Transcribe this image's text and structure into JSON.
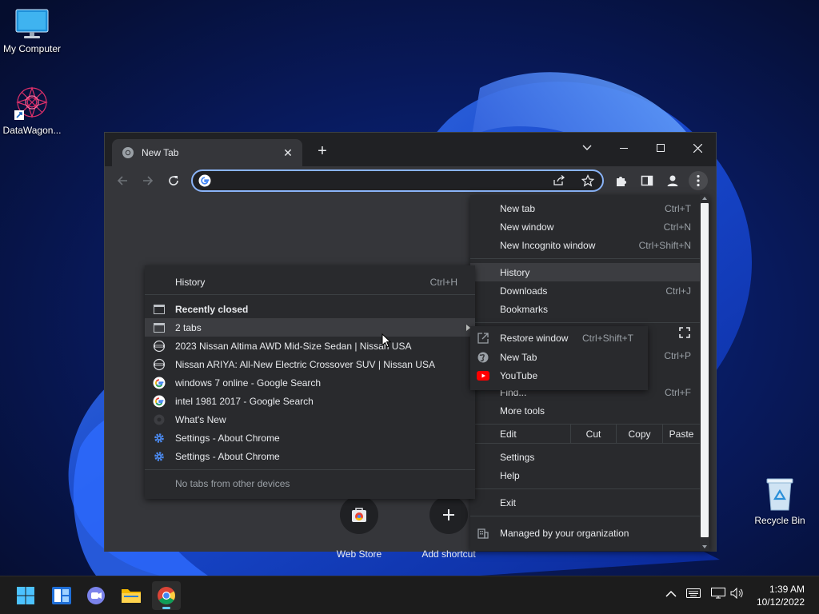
{
  "desktop": {
    "icons": [
      {
        "label": "My Computer"
      },
      {
        "label": "DataWagon..."
      },
      {
        "label": "Recycle Bin"
      }
    ]
  },
  "browser": {
    "tab_title": "New Tab",
    "omnibox_value": "",
    "shortcuts": [
      {
        "label": "Web Store"
      },
      {
        "label": "Add shortcut"
      }
    ]
  },
  "chrome_menu": {
    "items": [
      {
        "label": "New tab",
        "key": "Ctrl+T"
      },
      {
        "label": "New window",
        "key": "Ctrl+N"
      },
      {
        "label": "New Incognito window",
        "key": "Ctrl+Shift+N"
      },
      {
        "label": "History",
        "key": ""
      },
      {
        "label": "Downloads",
        "key": "Ctrl+J"
      },
      {
        "label": "Bookmarks",
        "key": ""
      },
      {
        "label": "",
        "key": "Ctrl+P"
      },
      {
        "label": "Find...",
        "key": "Ctrl+F"
      },
      {
        "label": "More tools",
        "key": ""
      },
      {
        "label": "Settings",
        "key": ""
      },
      {
        "label": "Help",
        "key": ""
      },
      {
        "label": "Exit",
        "key": ""
      },
      {
        "label": "Managed by your organization",
        "key": ""
      }
    ],
    "edit": {
      "label": "Edit",
      "cut": "Cut",
      "copy": "Copy",
      "paste": "Paste"
    }
  },
  "history_menu": {
    "header": {
      "label": "History",
      "key": "Ctrl+H"
    },
    "recently_closed": "Recently closed",
    "entries": [
      {
        "label": "2 tabs",
        "icon": "window-icon"
      },
      {
        "label": "2023 Nissan Altima AWD Mid-Size Sedan | Nissan USA",
        "icon": "nissan-icon"
      },
      {
        "label": "Nissan ARIYA: All-New Electric Crossover SUV | Nissan USA",
        "icon": "nissan-icon"
      },
      {
        "label": "windows 7 online - Google Search",
        "icon": "google-icon"
      },
      {
        "label": "intel 1981 2017 - Google Search",
        "icon": "google-icon"
      },
      {
        "label": "What's New",
        "icon": "chrome-icon"
      },
      {
        "label": "Settings - About Chrome",
        "icon": "settings-icon"
      },
      {
        "label": "Settings - About Chrome",
        "icon": "settings-icon"
      }
    ],
    "footer": "No tabs from other devices"
  },
  "tabs_submenu": {
    "items": [
      {
        "label": "Restore window",
        "key": "Ctrl+Shift+T",
        "icon": "restore-window-icon"
      },
      {
        "label": "New Tab",
        "key": "",
        "icon": "globe-icon"
      },
      {
        "label": "YouTube",
        "key": "",
        "icon": "youtube-icon"
      }
    ]
  },
  "taskbar": {
    "time": "1:39 AM",
    "date": "10/12/2022"
  },
  "colors": {
    "accent": "#8ab4f8",
    "menu_bg": "#292a2d",
    "toolbar_bg": "#35363a",
    "frame_bg": "#202124"
  }
}
